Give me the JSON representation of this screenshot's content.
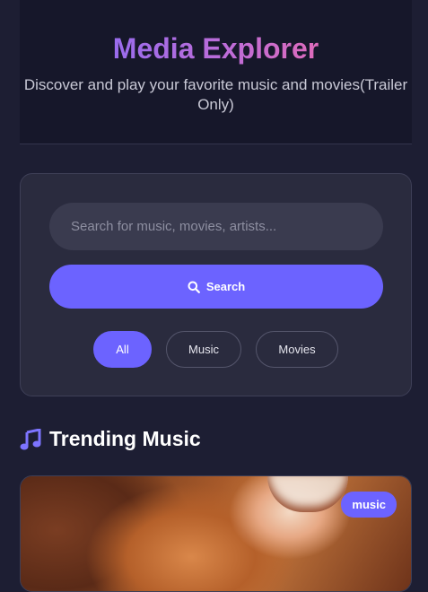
{
  "header": {
    "title": "Media Explorer",
    "subtitle": "Discover and play your favorite music and movies(Trailer Only)"
  },
  "search": {
    "placeholder": "Search for music, movies, artists...",
    "button_label": "Search",
    "button_icon": "search-icon"
  },
  "filters": [
    {
      "label": "All",
      "active": true
    },
    {
      "label": "Music",
      "active": false
    },
    {
      "label": "Movies",
      "active": false
    }
  ],
  "section": {
    "title": "Trending Music",
    "icon": "music-note-icon"
  },
  "cards": [
    {
      "badge": "music"
    }
  ],
  "colors": {
    "accent": "#6c63ff",
    "background": "#1d1e33",
    "title_gradient": [
      "#7b6cff",
      "#ff6a9c"
    ]
  }
}
